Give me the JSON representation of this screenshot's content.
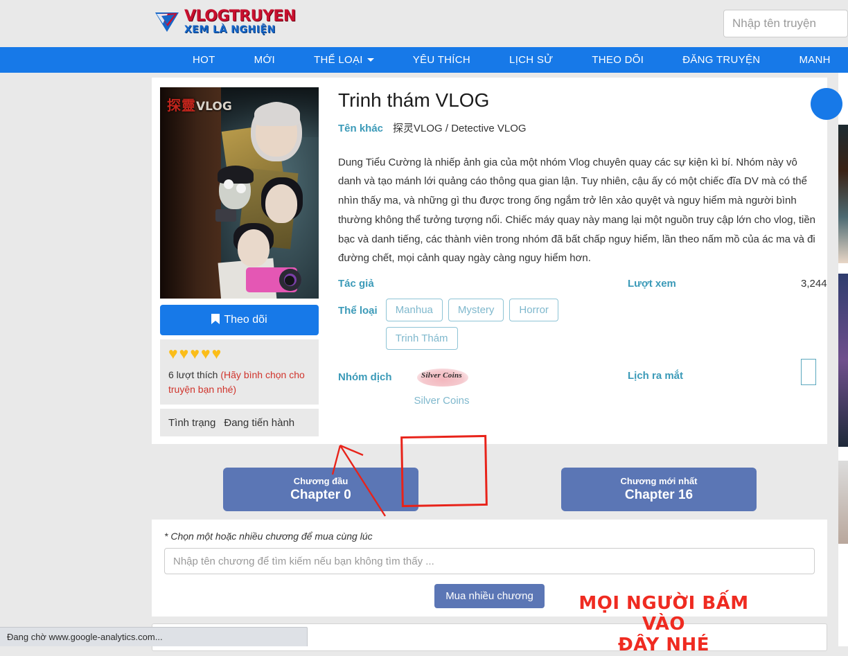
{
  "header": {
    "logo_main": "VLOGTRUYEN",
    "logo_sub": "XEM LÀ NGHIỆN",
    "search_placeholder": "Nhập tên truyện",
    "search_value": ""
  },
  "nav": {
    "items": [
      {
        "label": "HOT",
        "has_caret": false
      },
      {
        "label": "MỚI",
        "has_caret": false
      },
      {
        "label": "THỂ LOẠI",
        "has_caret": true
      },
      {
        "label": "YÊU THÍCH",
        "has_caret": false
      },
      {
        "label": "LỊCH SỬ",
        "has_caret": false
      },
      {
        "label": "THEO DÕI",
        "has_caret": false
      },
      {
        "label": "ĐĂNG TRUYỆN",
        "has_caret": false
      },
      {
        "label": "MANH",
        "has_caret": false
      }
    ]
  },
  "comic": {
    "title": "Trinh thám VLOG",
    "alt_label": "Tên khác",
    "alt_titles": "探灵VLOG / Detective VLOG",
    "cover_title_cn": "探靈",
    "cover_title_en": "VLOG",
    "description": "Dung Tiểu Cường là nhiếp ảnh gia của một nhóm Vlog chuyên quay các sự kiện kì bí. Nhóm này vô danh và tạo mánh lới quảng cáo thông qua gian lận. Tuy nhiên, cậu ấy có một chiếc đĩa DV mà có thể nhìn thấy ma, và những gì thu được trong ống ngắm trở lên xảo quyệt và nguy hiểm mà người bình thường không thể tưởng tượng nổi. Chiếc máy quay này mang lại một nguồn truy cập lớn cho vlog, tiền bạc và danh tiếng, các thành viên trong nhóm đã bất chấp nguy hiểm, lần theo nấm mồ của ác ma và đi đường chết, mọi cảnh quay ngày càng nguy hiểm hơn.",
    "author_label": "Tác giả",
    "author_value": "",
    "views_label": "Lượt xem",
    "views_value": "3,244",
    "genre_label": "Thể loại",
    "genres": [
      "Manhua",
      "Mystery",
      "Horror",
      "Trinh Thám"
    ],
    "group_label": "Nhóm dịch",
    "group_name": "Silver Coins",
    "group_logo_text": "Silver Coins",
    "schedule_label": "Lịch ra mắt",
    "schedule_value": ""
  },
  "sidebar": {
    "follow_label": "Theo dõi",
    "follow_icon": "bookmark-icon",
    "hearts": "♥♥♥♥♥",
    "heart_count": 5,
    "likes_text": "6 lượt thích",
    "likes_note": "(Hãy bình chọn cho truyện bạn nhé)",
    "status_label": "Tình trạng",
    "status_value": "Đang tiến hành"
  },
  "chapters": {
    "first_caption": "Chương đầu",
    "first_value": "Chapter 0",
    "latest_caption": "Chương mới nhất",
    "latest_value": "Chapter 16"
  },
  "purchase": {
    "note": "* Chọn một hoặc nhiều chương để mua cùng lúc",
    "search_placeholder": "Nhập tên chương để tìm kiếm nếu bạn không tìm thấy ...",
    "search_value": "",
    "buy_button": "Mua nhiều chương"
  },
  "annotation": {
    "text_line1": "MỌI NGƯỜI BẤM VÀO",
    "text_line2": "ĐÂY NHÉ",
    "color": "#ef2b21"
  },
  "browser": {
    "status_text": "Đang chờ www.google-analytics.com..."
  },
  "colors": {
    "nav_blue": "#1779e8",
    "accent_teal": "#3b9ab8",
    "chip_border": "#8ec4d6",
    "button_purple": "#5b76b5",
    "heart_yellow": "#fbbd19",
    "annotation_red": "#ef2b21",
    "page_bg": "#e9e9e9"
  }
}
